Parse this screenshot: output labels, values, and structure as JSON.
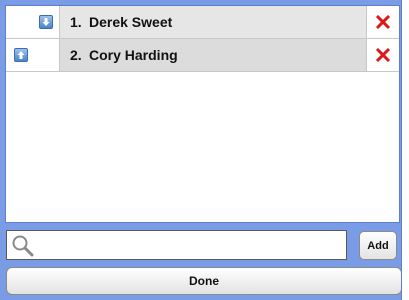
{
  "list": {
    "items": [
      {
        "index": "1.",
        "name": "Derek Sweet",
        "move_icon": "arrow-down-icon",
        "delete_icon": "close-icon"
      },
      {
        "index": "2.",
        "name": "Cory Harding",
        "move_icon": "arrow-up-icon",
        "delete_icon": "close-icon"
      }
    ]
  },
  "search": {
    "value": "",
    "placeholder": "",
    "icon": "search-icon"
  },
  "buttons": {
    "add_label": "Add",
    "done_label": "Done"
  },
  "colors": {
    "background": "#7a9ce6",
    "delete": "#e01515",
    "arrow": "#4d84c8"
  }
}
